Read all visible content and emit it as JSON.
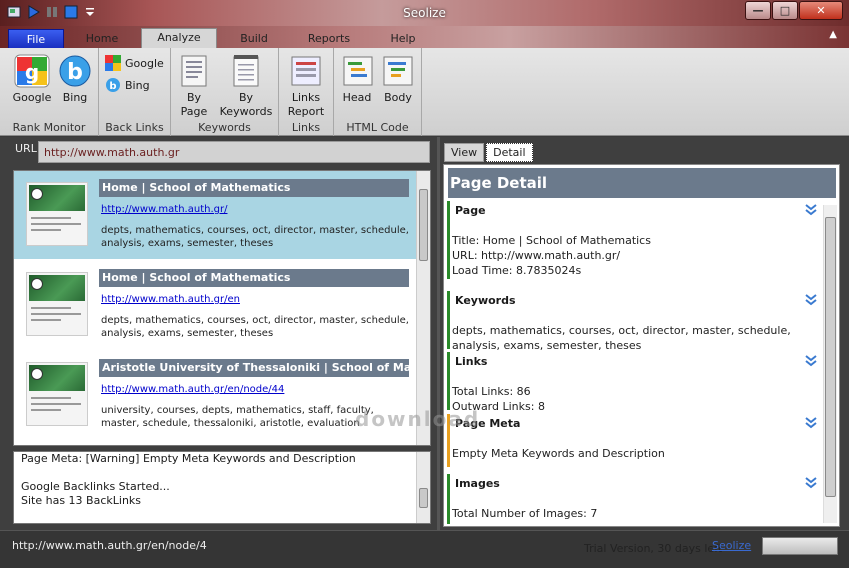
{
  "window": {
    "title": "Seolize"
  },
  "ribbon": {
    "file_tab": "File",
    "tabs": [
      "Home",
      "Analyze",
      "Build",
      "Reports",
      "Help"
    ],
    "active_tab": "Analyze",
    "groups": {
      "rank_monitor": {
        "label": "Rank Monitor",
        "google": "Google",
        "bing": "Bing"
      },
      "back_links": {
        "label": "Back Links",
        "google": "Google",
        "bing": "Bing"
      },
      "keywords": {
        "label": "Keywords",
        "by_page_1": "By",
        "by_page_2": "Page",
        "by_keywords_1": "By",
        "by_keywords_2": "Keywords"
      },
      "links": {
        "label": "Links",
        "report_1": "Links",
        "report_2": "Report"
      },
      "html_code": {
        "label": "HTML Code",
        "head": "Head",
        "body": "Body"
      }
    }
  },
  "url_bar": {
    "label": "URL:",
    "value": "http://www.math.auth.gr"
  },
  "results": [
    {
      "title": "Home | School of Mathematics",
      "url": "http://www.math.auth.gr/",
      "desc": "depts, mathematics, courses, oct, director, master, schedule, analysis, exams, semester, theses"
    },
    {
      "title": "Home | School of Mathematics",
      "url": "http://www.math.auth.gr/en",
      "desc": "depts, mathematics, courses, oct, director, master, schedule, analysis, exams, semester, theses"
    },
    {
      "title": "Aristotle University of Thessaloniki | School of Mathematics",
      "url": "http://www.math.auth.gr/en/node/44",
      "desc": "university, courses, depts, mathematics, staff, faculty, master, schedule, thessaloniki, aristotle, evaluation"
    }
  ],
  "log": {
    "text": "Page Meta: [Warning] Empty Meta Keywords and Description\n\nGoogle Backlinks Started...\nSite has 13 BackLinks"
  },
  "detail_tabs": [
    "View",
    "Detail"
  ],
  "detail": {
    "header": "Page Detail",
    "page": {
      "title": "Page",
      "line1": "Title: Home | School of Mathematics",
      "line2": "URL: http://www.math.auth.gr/",
      "line3": "Load Time: 8.7835024s"
    },
    "keywords": {
      "title": "Keywords",
      "text": "depts, mathematics, courses, oct, director, master, schedule, analysis, exams, semester, theses"
    },
    "links": {
      "title": "Links",
      "line1": "Total Links: 86",
      "line2": "Outward Links: 8"
    },
    "page_meta": {
      "title": "Page Meta",
      "text": "Empty Meta Keywords and Description"
    },
    "images": {
      "title": "Images",
      "text": "Total Number of Images: 7"
    }
  },
  "watermark": "download",
  "status": {
    "current_url": "http://www.math.auth.gr/en/node/4",
    "trial": "Trial Version, 30 days left",
    "link": "Seolize"
  },
  "colors": {
    "file_tab": "#1a2fc0",
    "header_bg": "#6b7a8c",
    "selected_row": "#a9d5e3",
    "ok_bar": "#2a8a2a",
    "warn_bar": "#e8a020"
  }
}
